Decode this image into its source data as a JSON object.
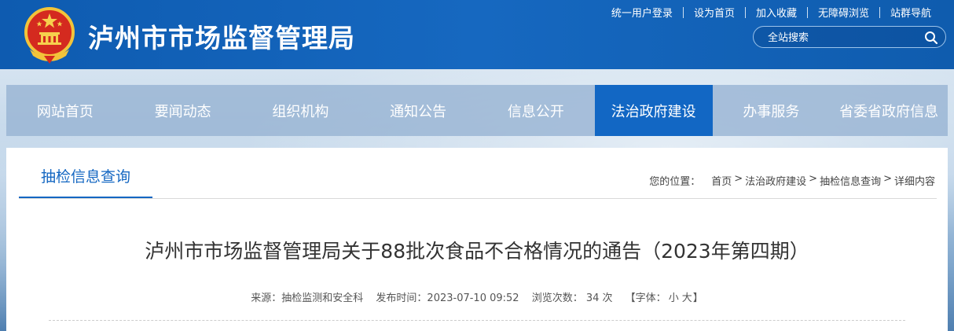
{
  "header": {
    "site_title": "泸州市市场监督管理局",
    "top_links": [
      "统一用户登录",
      "设为首页",
      "加入收藏",
      "无障碍浏览",
      "站群导航"
    ],
    "search_placeholder": "全站搜索"
  },
  "nav": {
    "items": [
      "网站首页",
      "要闻动态",
      "组织机构",
      "通知公告",
      "信息公开",
      "法治政府建设",
      "办事服务",
      "省委省政府信息"
    ],
    "active": "法治政府建设"
  },
  "section": {
    "tab_label": "抽检信息查询"
  },
  "breadcrumb": {
    "label": "您的位置：",
    "items": [
      "首页",
      "法治政府建设",
      "抽检信息查询",
      "详细内容"
    ],
    "separator": ">"
  },
  "article": {
    "title": "泸州市市场监督管理局关于88批次食品不合格情况的通告（2023年第四期）",
    "source": "来源：抽检监测和安全科",
    "publish_time": "发布时间：2023-07-10 09:52",
    "views": "浏览次数： 34 次",
    "font_label": "【字体：",
    "font_small": "小",
    "font_large": "大",
    "font_close": "】"
  },
  "colors": {
    "header_blue": "#1668c0",
    "active_nav": "#1267c4",
    "accent": "#1467c2"
  }
}
